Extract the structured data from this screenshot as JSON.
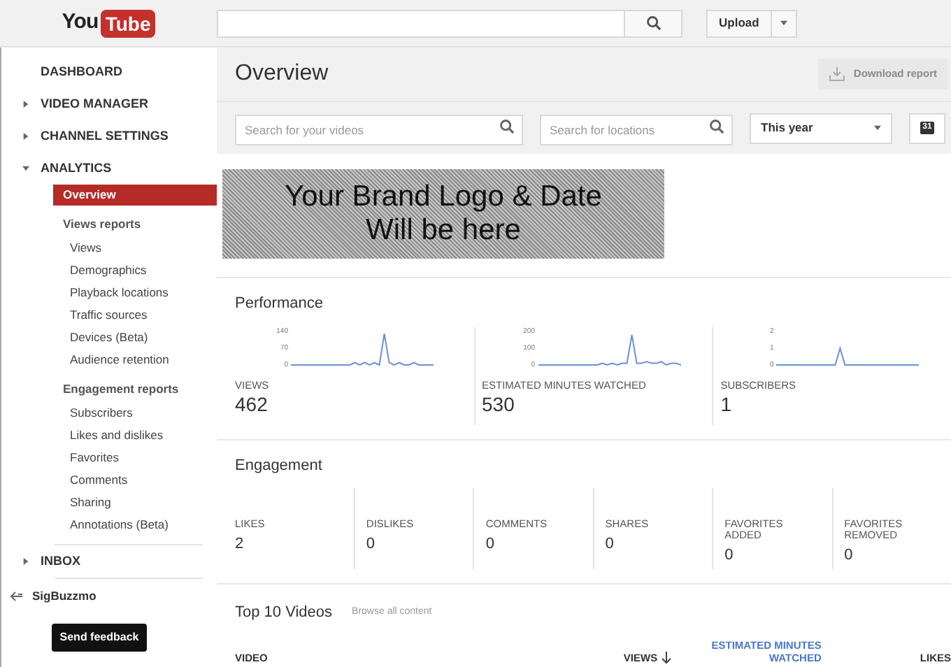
{
  "header": {
    "logo": {
      "you": "You",
      "tube": "Tube"
    },
    "upload": "Upload"
  },
  "sidebar": {
    "items": [
      {
        "kind": "section",
        "label": "DASHBOARD"
      },
      {
        "kind": "section",
        "label": "VIDEO MANAGER",
        "expanded": false
      },
      {
        "kind": "section",
        "label": "CHANNEL SETTINGS",
        "expanded": false
      },
      {
        "kind": "section",
        "label": "ANALYTICS",
        "expanded": true,
        "children": [
          {
            "kind": "link",
            "label": "Overview",
            "selected": true
          },
          {
            "kind": "heading",
            "label": "Views reports",
            "children": [
              {
                "kind": "link",
                "label": "Views",
                "selected": false
              },
              {
                "kind": "link",
                "label": "Demographics",
                "selected": false
              },
              {
                "kind": "link",
                "label": "Playback locations",
                "selected": false
              },
              {
                "kind": "link",
                "label": "Traffic sources",
                "selected": false
              },
              {
                "kind": "link",
                "label": "Devices (Beta)",
                "selected": false
              },
              {
                "kind": "link",
                "label": "Audience retention",
                "selected": false
              }
            ]
          },
          {
            "kind": "heading",
            "label": "Engagement reports",
            "children": [
              {
                "kind": "link",
                "label": "Subscribers",
                "selected": false
              },
              {
                "kind": "link",
                "label": "Likes and dislikes",
                "selected": false
              },
              {
                "kind": "link",
                "label": "Favorites",
                "selected": false
              },
              {
                "kind": "link",
                "label": "Comments",
                "selected": false
              },
              {
                "kind": "link",
                "label": "Sharing",
                "selected": false
              },
              {
                "kind": "link",
                "label": "Annotations (Beta)",
                "selected": false
              }
            ]
          }
        ]
      },
      {
        "kind": "section",
        "label": "INBOX",
        "expanded": false
      }
    ],
    "channel": "SigBuzzmo",
    "feedback": "Send feedback"
  },
  "page": {
    "title": "Overview",
    "download_report": {
      "label": "Download report",
      "disabled": true
    }
  },
  "filters": {
    "video_search": {
      "placeholder": "Search for your videos"
    },
    "location_search": {
      "placeholder": "Search for locations"
    },
    "period": "This year",
    "calendar": "31"
  },
  "banner": [
    "Your Brand Logo & Date",
    "Will be here"
  ],
  "performance": {
    "title": "Performance",
    "metrics": [
      {
        "label": "VIEWS",
        "value": "462",
        "chart_data": {
          "type": "line",
          "yticks": [
            0,
            70,
            140
          ],
          "ylim": [
            0,
            140
          ],
          "series": [
            {
              "color": "#6b8fd6",
              "values": [
                0,
                0,
                0,
                0,
                0,
                0,
                0,
                0,
                0,
                0,
                0,
                0,
                0,
                10,
                0,
                10,
                0,
                10,
                0,
                130,
                10,
                0,
                10,
                0,
                0,
                10,
                0,
                0,
                0,
                0
              ]
            }
          ]
        }
      },
      {
        "label": "ESTIMATED MINUTES WATCHED",
        "value": "530",
        "chart_data": {
          "type": "line",
          "yticks": [
            0,
            100,
            200
          ],
          "ylim": [
            0,
            200
          ],
          "series": [
            {
              "color": "#6b8fd6",
              "values": [
                0,
                0,
                0,
                0,
                0,
                0,
                0,
                0,
                0,
                0,
                0,
                0,
                0,
                10,
                0,
                10,
                0,
                10,
                10,
                180,
                10,
                10,
                20,
                10,
                10,
                20,
                0,
                10,
                10,
                0
              ]
            }
          ]
        }
      },
      {
        "label": "SUBSCRIBERS",
        "value": "1",
        "chart_data": {
          "type": "line",
          "yticks": [
            0,
            1,
            2
          ],
          "ylim": [
            0,
            2
          ],
          "series": [
            {
              "color": "#6b8fd6",
              "values": [
                0,
                0,
                0,
                0,
                0,
                0,
                0,
                0,
                0,
                0,
                0,
                0,
                0,
                1,
                0,
                0,
                0,
                0,
                0,
                0,
                0,
                0,
                0,
                0,
                0,
                0,
                0,
                0,
                0,
                0
              ]
            }
          ]
        }
      }
    ]
  },
  "engagement": {
    "title": "Engagement",
    "metrics": [
      {
        "label": "LIKES",
        "value": "2"
      },
      {
        "label": "DISLIKES",
        "value": "0"
      },
      {
        "label": "COMMENTS",
        "value": "0"
      },
      {
        "label": "SHARES",
        "value": "0"
      },
      {
        "label": "FAVORITES ADDED",
        "value": "0"
      },
      {
        "label": "FAVORITES REMOVED",
        "value": "0"
      }
    ]
  },
  "top_videos": {
    "title": "Top 10 Videos",
    "link": "Browse all content",
    "columns": [
      {
        "label": "VIDEO",
        "kind": "plain"
      },
      {
        "label": "VIEWS",
        "kind": "sorted"
      },
      {
        "label": "ESTIMATED MINUTES WATCHED",
        "kind": "link"
      },
      {
        "label": "LIKES",
        "kind": "plain"
      }
    ]
  }
}
